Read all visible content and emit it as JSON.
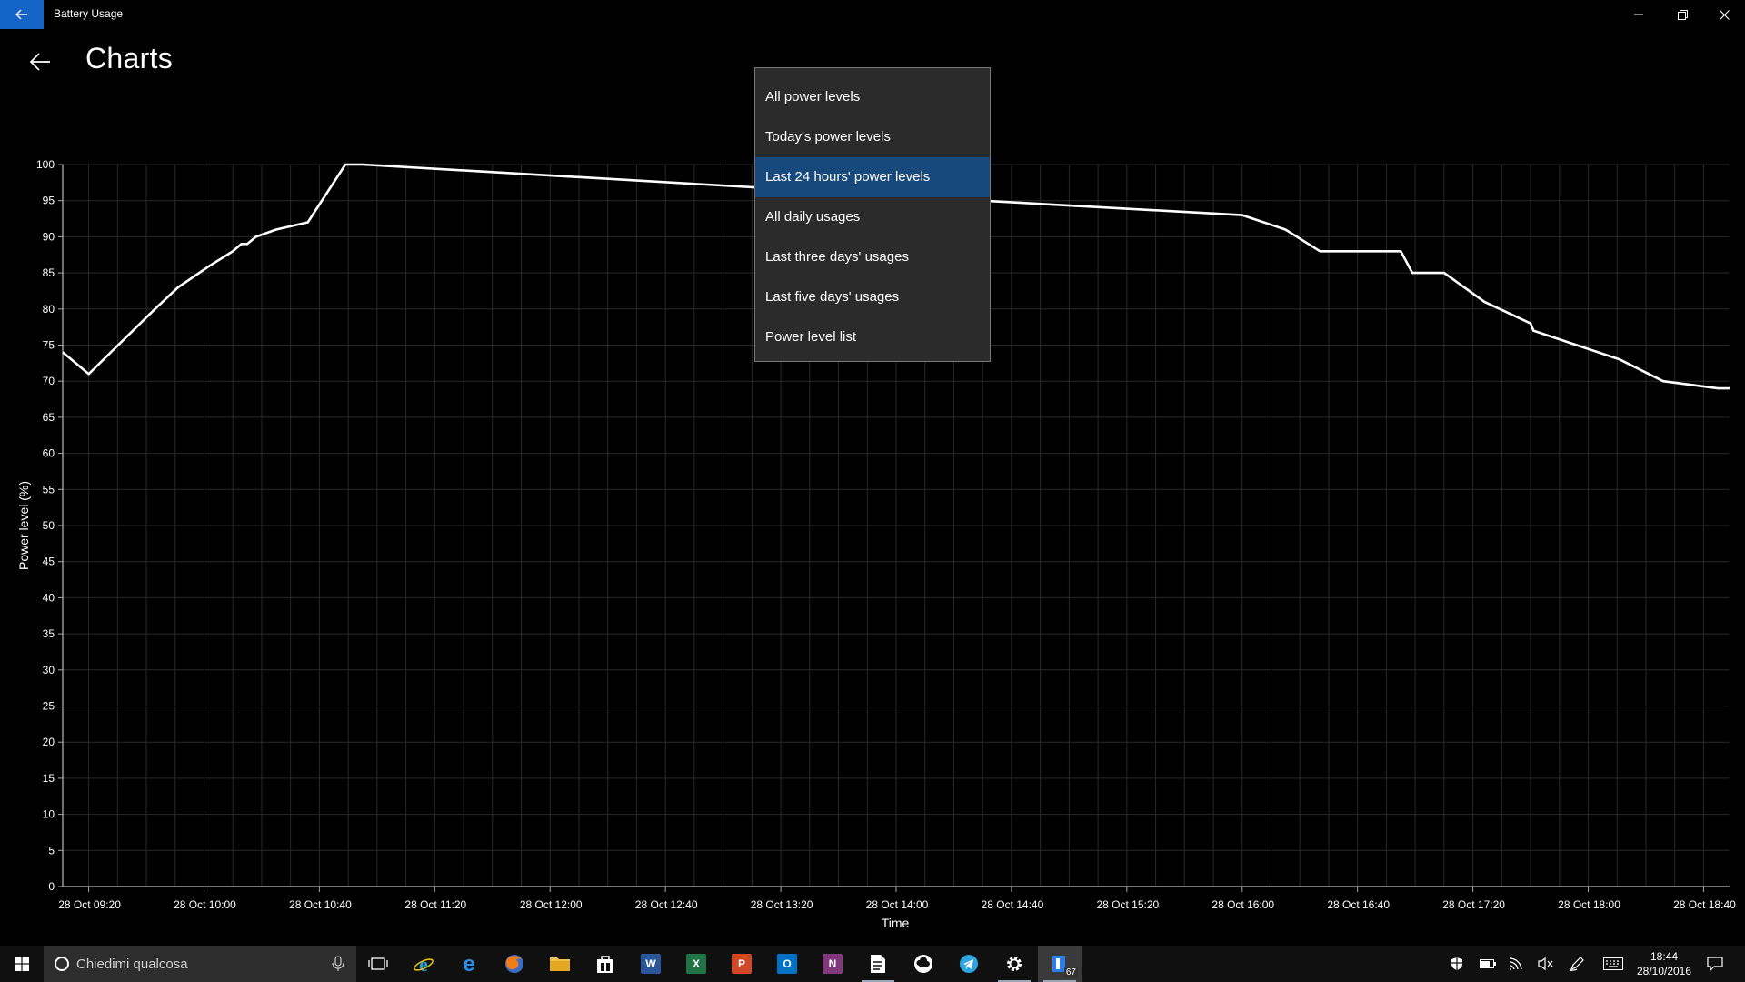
{
  "window": {
    "title": "Battery Usage"
  },
  "page": {
    "title": "Charts"
  },
  "menu": {
    "items": [
      {
        "label": "All power levels",
        "selected": false
      },
      {
        "label": "Today's power levels",
        "selected": false
      },
      {
        "label": "Last 24 hours' power levels",
        "selected": true
      },
      {
        "label": "All daily usages",
        "selected": false
      },
      {
        "label": "Last three days' usages",
        "selected": false
      },
      {
        "label": "Last five days' usages",
        "selected": false
      },
      {
        "label": "Power level list",
        "selected": false
      }
    ]
  },
  "chart_data": {
    "type": "line",
    "xlabel": "Time",
    "ylabel": "Power level (%)",
    "ylim": [
      0,
      100
    ],
    "yticks": [
      0,
      5,
      10,
      15,
      20,
      25,
      30,
      35,
      40,
      45,
      50,
      55,
      60,
      65,
      70,
      75,
      80,
      85,
      90,
      95,
      100
    ],
    "xlim": [
      "2016-10-28T09:11",
      "2016-10-28T18:49"
    ],
    "xtick_labels": [
      "28 Oct 09:20",
      "28 Oct 10:00",
      "28 Oct 10:40",
      "28 Oct 11:20",
      "28 Oct 12:00",
      "28 Oct 12:40",
      "28 Oct 13:20",
      "28 Oct 14:00",
      "28 Oct 14:40",
      "28 Oct 15:20",
      "28 Oct 16:00",
      "28 Oct 16:40",
      "28 Oct 17:20",
      "28 Oct 18:00",
      "28 Oct 18:40"
    ],
    "xtick_times": [
      "2016-10-28T09:20",
      "2016-10-28T10:00",
      "2016-10-28T10:40",
      "2016-10-28T11:20",
      "2016-10-28T12:00",
      "2016-10-28T12:40",
      "2016-10-28T13:20",
      "2016-10-28T14:00",
      "2016-10-28T14:40",
      "2016-10-28T15:20",
      "2016-10-28T16:00",
      "2016-10-28T16:40",
      "2016-10-28T17:20",
      "2016-10-28T18:00",
      "2016-10-28T18:40"
    ],
    "grid": true,
    "line_color": "#ffffff",
    "points": [
      {
        "x": "2016-10-28T09:11",
        "y": 74
      },
      {
        "x": "2016-10-28T09:20",
        "y": 71
      },
      {
        "x": "2016-10-28T09:43",
        "y": 80
      },
      {
        "x": "2016-10-28T09:51",
        "y": 83
      },
      {
        "x": "2016-10-28T10:02",
        "y": 86
      },
      {
        "x": "2016-10-28T10:10",
        "y": 88
      },
      {
        "x": "2016-10-28T10:13",
        "y": 89
      },
      {
        "x": "2016-10-28T10:15",
        "y": 89
      },
      {
        "x": "2016-10-28T10:18",
        "y": 90
      },
      {
        "x": "2016-10-28T10:25",
        "y": 91
      },
      {
        "x": "2016-10-28T10:36",
        "y": 92
      },
      {
        "x": "2016-10-28T10:49",
        "y": 100
      },
      {
        "x": "2016-10-28T10:55",
        "y": 100
      },
      {
        "x": "2016-10-28T14:30",
        "y": 95
      },
      {
        "x": "2016-10-28T16:00",
        "y": 93
      },
      {
        "x": "2016-10-28T16:15",
        "y": 91
      },
      {
        "x": "2016-10-28T16:27",
        "y": 88
      },
      {
        "x": "2016-10-28T16:55",
        "y": 88
      },
      {
        "x": "2016-10-28T16:59",
        "y": 85
      },
      {
        "x": "2016-10-28T17:10",
        "y": 85
      },
      {
        "x": "2016-10-28T17:24",
        "y": 81
      },
      {
        "x": "2016-10-28T17:40",
        "y": 78
      },
      {
        "x": "2016-10-28T17:41",
        "y": 77
      },
      {
        "x": "2016-10-28T18:11",
        "y": 73
      },
      {
        "x": "2016-10-28T18:26",
        "y": 70
      },
      {
        "x": "2016-10-28T18:45",
        "y": 69
      },
      {
        "x": "2016-10-28T18:49",
        "y": 69
      }
    ]
  },
  "taskbar": {
    "search_placeholder": "Chiedimi qualcosa",
    "apps": [
      {
        "name": "task-view"
      },
      {
        "name": "internet-explorer"
      },
      {
        "name": "edge"
      },
      {
        "name": "firefox"
      },
      {
        "name": "file-explorer"
      },
      {
        "name": "store"
      },
      {
        "name": "word",
        "letter": "W",
        "color": "#2b579a"
      },
      {
        "name": "excel",
        "letter": "X",
        "color": "#217346"
      },
      {
        "name": "powerpoint",
        "letter": "P",
        "color": "#d24726"
      },
      {
        "name": "outlook",
        "letter": "O",
        "color": "#0072c6"
      },
      {
        "name": "onenote",
        "letter": "N",
        "color": "#80397b"
      },
      {
        "name": "document-app"
      },
      {
        "name": "cloud-app"
      },
      {
        "name": "telegram"
      },
      {
        "name": "settings"
      },
      {
        "name": "battery-usage"
      }
    ],
    "battery_badge": "67",
    "time": "18:44",
    "date": "28/10/2016"
  }
}
